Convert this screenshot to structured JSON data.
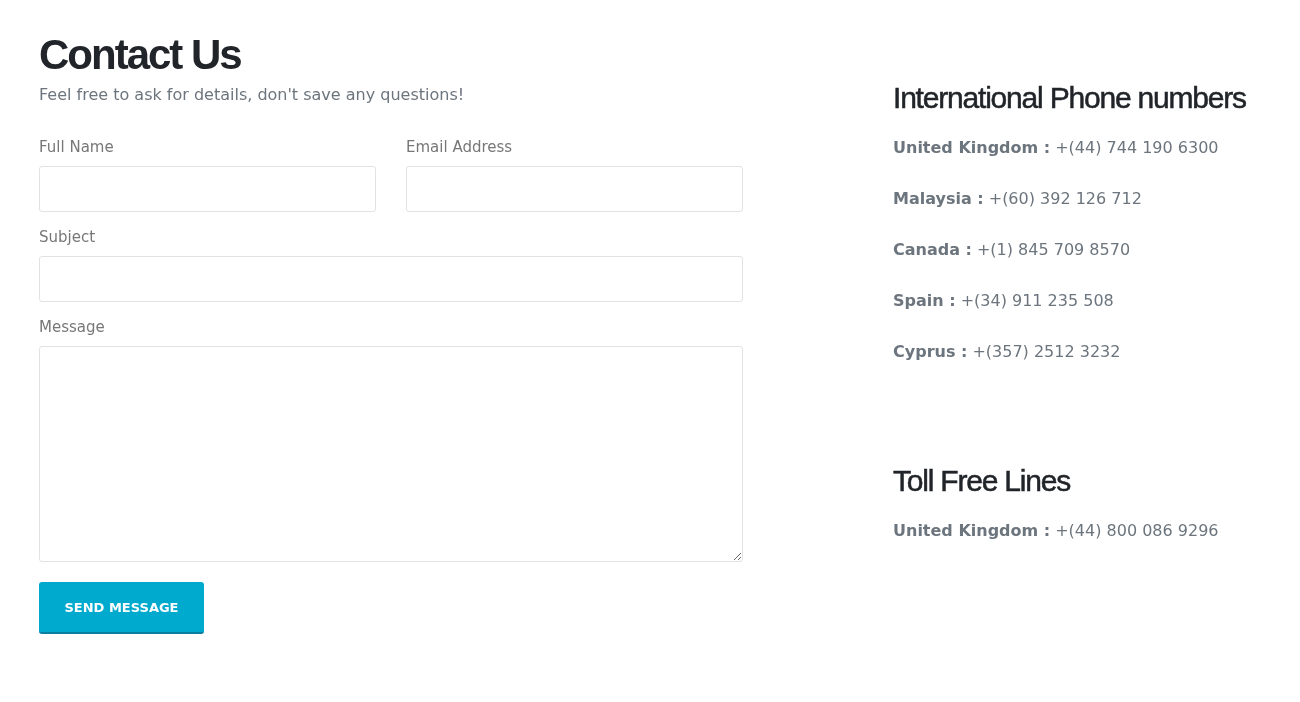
{
  "header": {
    "title": "Contact Us",
    "subtitle": "Feel free to ask for details, don't save any questions!"
  },
  "form": {
    "rows": [
      [
        {
          "label": "Full Name",
          "kind": "input"
        },
        {
          "label": "Email Address",
          "kind": "input"
        }
      ],
      [
        {
          "label": "Subject",
          "kind": "input"
        }
      ],
      [
        {
          "label": "Message",
          "kind": "textarea"
        }
      ]
    ],
    "submit": "SEND MESSAGE"
  },
  "sections": [
    {
      "title": "International Phone numbers",
      "entries": [
        {
          "country": "United Kingdom :",
          "number": "+(44) 744 190 6300"
        },
        {
          "country": "Malaysia :",
          "number": "+(60) 392 126 712"
        },
        {
          "country": "Canada :",
          "number": "+(1) 845 709 8570"
        },
        {
          "country": "Spain :",
          "number": "+(34) 911 235 508"
        },
        {
          "country": "Cyprus :",
          "number": "+(357) 2512 3232"
        }
      ]
    },
    {
      "title": "Toll Free Lines",
      "entries": [
        {
          "country": "United Kingdom :",
          "number": "+(44) 800 086 9296"
        }
      ]
    }
  ]
}
